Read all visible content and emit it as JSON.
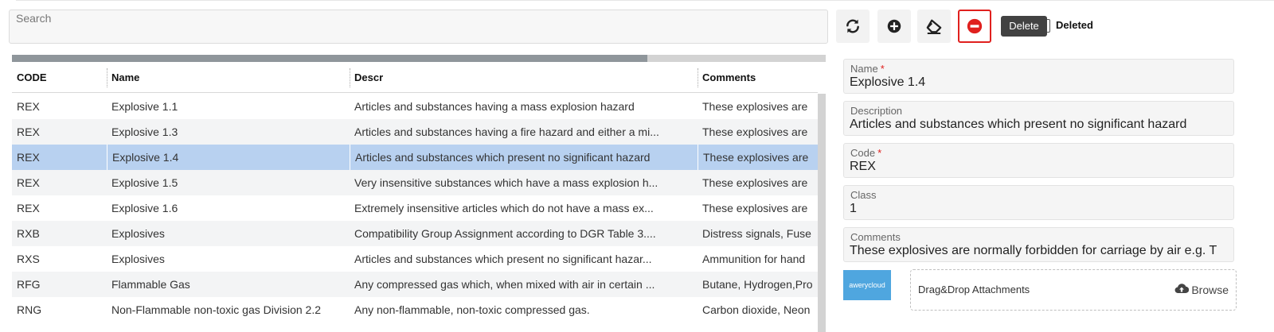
{
  "search": {
    "placeholder": "Search"
  },
  "grid": {
    "columns": [
      "CODE",
      "Name",
      "Descr",
      "Comments"
    ],
    "rows": [
      [
        "REX",
        "Explosive 1.1",
        "Articles and substances having a mass explosion hazard",
        "These explosives are"
      ],
      [
        "REX",
        "Explosive 1.3",
        "Articles and substances having a fire hazard and either a mi...",
        "These explosives are"
      ],
      [
        "REX",
        "Explosive 1.4",
        "Articles and substances which present no significant hazard",
        "These explosives are"
      ],
      [
        "REX",
        "Explosive 1.5",
        "Very insensitive substances which have a mass explosion h...",
        "These explosives are"
      ],
      [
        "REX",
        "Explosive 1.6",
        "Extremely insensitive articles which do not have a mass ex...",
        "These explosives are"
      ],
      [
        "RXB",
        "Explosives",
        "Compatibility Group Assignment according to DGR Table 3....",
        "Distress signals, Fuse"
      ],
      [
        "RXS",
        "Explosives",
        "Articles and substances which present no significant hazar...",
        "Ammunition for hand"
      ],
      [
        "RFG",
        "Flammable Gas",
        "Any compressed gas which, when mixed with air in certain ...",
        "Butane, Hydrogen,Pro"
      ],
      [
        "RNG",
        "Non-Flammable non-toxic gas Division 2.2",
        "Any non-flammable, non-toxic compressed gas.",
        "Carbon dioxide, Neon"
      ]
    ],
    "selected_row": 2
  },
  "toolbar": {
    "refresh_icon": "refresh-icon",
    "add_icon": "plus-circle-icon",
    "clear_icon": "eraser-icon",
    "delete_icon": "minus-circle-icon",
    "delete_tooltip": "Delete",
    "deleted_label": "Deleted",
    "active_color": "#e0201e"
  },
  "form": {
    "name": {
      "label": "Name",
      "value": "Explosive 1.4"
    },
    "description": {
      "label": "Description",
      "value": " Articles and substances which present no significant hazard"
    },
    "code": {
      "label": "Code",
      "value": "REX"
    },
    "class": {
      "label": "Class",
      "value": "1"
    },
    "comments": {
      "label": "Comments",
      "value": "These explosives are normally forbidden for carriage by air e.g. T"
    },
    "required_mark": "*"
  },
  "attachments": {
    "logo_text": "awerycloud",
    "drop_text": "Drag&Drop Attachments",
    "browse_label": "Browse"
  }
}
